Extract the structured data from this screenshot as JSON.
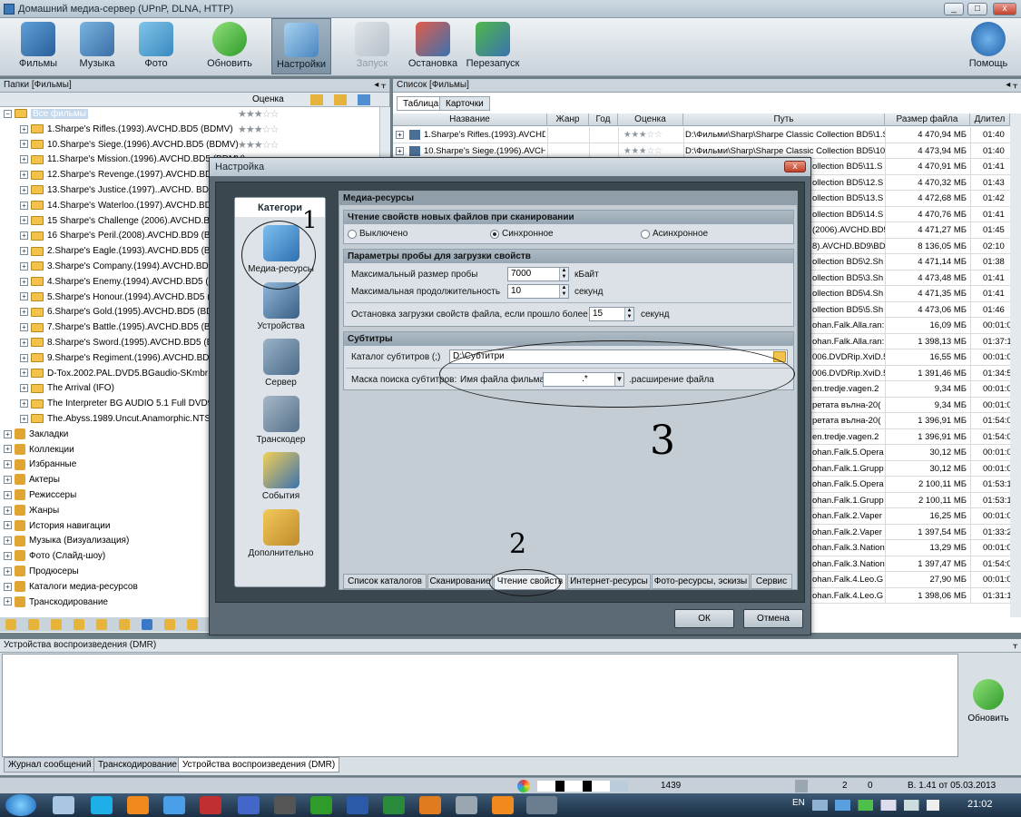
{
  "window": {
    "title": "Домашний медиа-сервер (UPnP, DLNA, HTTP)",
    "min": "_",
    "max": "□",
    "close": "x"
  },
  "toolbar": {
    "films": "Фильмы",
    "music": "Музыка",
    "photo": "Фото",
    "refresh": "Обновить",
    "settings": "Настройки",
    "start": "Запуск",
    "stop": "Остановка",
    "restart": "Перезапуск",
    "help": "Помощь"
  },
  "left": {
    "header": "Папки [Фильмы]",
    "rating_col": "Оценка",
    "root": "Все фильмы",
    "films": [
      "1.Sharpe's Rifles.(1993).AVCHD.BD5 (BDMV)",
      "10.Sharpe's Siege.(1996).AVCHD.BD5 (BDMV)",
      "11.Sharpe's Mission.(1996).AVCHD.BD5 (BDMV)",
      "12.Sharpe's Revenge.(1997).AVCHD.BD5 (BDMV)",
      "13.Sharpe's Justice.(1997)..AVCHD. BD5 (BDMV)",
      "14.Sharpe's Waterloo.(1997).AVCHD.BD5 (BDMV)",
      "15 Sharpe's Challenge (2006).AVCHD.BD5 (BDMV)",
      "16 Sharpe's Peril.(2008).AVCHD.BD9 (BDMV)",
      "2.Sharpe's Eagle.(1993).AVCHD.BD5 (BDMV)",
      "3.Sharpe's Company.(1994).AVCHD.BD5 (BDMV)",
      "4.Sharpe's Enemy.(1994).AVCHD.BD5 (BDMV)",
      "5.Sharpe's Honour.(1994).AVCHD.BD5 (BDMV)",
      "6.Sharpe's Gold.(1995).AVCHD.BD5 (BDMV)",
      "7.Sharpe's Battle.(1995).AVCHD.BD5 (BDMV)",
      "8.Sharpe's Sword.(1995).AVCHD.BD5 (BDMV)",
      "9.Sharpe's Regiment.(1996).AVCHD.BD5 (BDMV)",
      "D-Tox.2002.PAL.DVD5.BGaudio-SKmbr (IFO)",
      "The Arrival (IFO)",
      "The Interpreter BG AUDIO 5.1 Full DVD9 (IFO)",
      "The.Abyss.1989.Uncut.Anamorphic.NTSC (IFO)"
    ],
    "categories": [
      "Закладки",
      "Коллекции",
      "Избранные",
      "Актеры",
      "Режиссеры",
      "Жанры",
      "История навигации",
      "Музыка (Визуализация)",
      "Фото (Слайд-шоу)",
      "Продюсеры",
      "Каталоги медиа-ресурсов",
      "Транскодирование"
    ]
  },
  "right": {
    "header": "Список [Фильмы]",
    "tab_table": "Таблица",
    "tab_cards": "Карточки",
    "columns": [
      "Название",
      "Жанр",
      "Год",
      "Оценка",
      "Путь",
      "Размер файла",
      "Длител"
    ],
    "rows": [
      {
        "name": "1.Sharpe's Rifles.(1993).AVCHD.BD5",
        "path": "D:\\Фильми\\Sharp\\Sharpe Classic Collection BD5\\1.Sh",
        "size": "4 470,94 МБ",
        "dur": "01:40"
      },
      {
        "name": "10.Sharpe's Siege.(1996).AVCHD.BD5",
        "path": "D:\\Фильми\\Sharp\\Sharpe Classic Collection BD5\\10.S",
        "size": "4 473,94 МБ",
        "dur": "01:40"
      },
      {
        "path": "ollection BD5\\11.S",
        "size": "4 470,91 МБ",
        "dur": "01:41"
      },
      {
        "path": "ollection BD5\\12.S",
        "size": "4 470,32 МБ",
        "dur": "01:43"
      },
      {
        "path": "ollection BD5\\13.S",
        "size": "4 472,68 МБ",
        "dur": "01:42"
      },
      {
        "path": "ollection BD5\\14.S",
        "size": "4 470,76 МБ",
        "dur": "01:41"
      },
      {
        "path": "(2006).AVCHD.BD5",
        "size": "4 471,27 МБ",
        "dur": "01:45"
      },
      {
        "path": "8).AVCHD.BD9\\BDM",
        "size": "8 136,05 МБ",
        "dur": "02:10"
      },
      {
        "path": "ollection BD5\\2.Sh",
        "size": "4 471,14 МБ",
        "dur": "01:38"
      },
      {
        "path": "ollection BD5\\3.Sh",
        "size": "4 473,48 МБ",
        "dur": "01:41"
      },
      {
        "path": "ollection BD5\\4.Sh",
        "size": "4 471,35 МБ",
        "dur": "01:41"
      },
      {
        "path": "ollection BD5\\5.Sh",
        "size": "4 473,06 МБ",
        "dur": "01:46"
      },
      {
        "path": "ohan.Falk.Alla.ran:",
        "size": "16,09 МБ",
        "dur": "00:01:0"
      },
      {
        "path": "ohan.Falk.Alla.ran:",
        "size": "1 398,13 МБ",
        "dur": "01:37:1"
      },
      {
        "path": "006.DVDRip.XviD.5",
        "size": "16,55 МБ",
        "dur": "00:01:0"
      },
      {
        "path": "006.DVDRip.XviD.5",
        "size": "1 391,46 МБ",
        "dur": "01:34:5"
      },
      {
        "path": "en.tredje.vagen.2",
        "size": "9,34 МБ",
        "dur": "00:01:0"
      },
      {
        "path": "ретата вълна-20(",
        "size": "9,34 МБ",
        "dur": "00:01:0"
      },
      {
        "path": "ретата вълна-20(",
        "size": "1 396,91 МБ",
        "dur": "01:54:0"
      },
      {
        "path": "en.tredje.vagen.2",
        "size": "1 396,91 МБ",
        "dur": "01:54:0"
      },
      {
        "path": "ohan.Falk.5.Opera",
        "size": "30,12 МБ",
        "dur": "00:01:0"
      },
      {
        "path": "ohan.Falk.1.Grupp",
        "size": "30,12 МБ",
        "dur": "00:01:0"
      },
      {
        "path": "ohan.Falk.5.Opera",
        "size": "2 100,11 МБ",
        "dur": "01:53:1"
      },
      {
        "path": "ohan.Falk.1.Grupp",
        "size": "2 100,11 МБ",
        "dur": "01:53:1"
      },
      {
        "path": "ohan.Falk.2.Vaper",
        "size": "16,25 МБ",
        "dur": "00:01:0"
      },
      {
        "path": "ohan.Falk.2.Vaper",
        "size": "1 397,54 МБ",
        "dur": "01:33:2"
      },
      {
        "path": "ohan.Falk.3.Nation",
        "size": "13,29 МБ",
        "dur": "00:01:0"
      },
      {
        "path": "ohan.Falk.3.Nation",
        "size": "1 397,47 МБ",
        "dur": "01:54:0"
      },
      {
        "path": "ohan.Falk.4.Leo.G",
        "size": "27,90 МБ",
        "dur": "00:01:0"
      },
      {
        "path": "ohan.Falk.4.Leo.G",
        "size": "1 398,06 МБ",
        "dur": "01:31:1"
      }
    ]
  },
  "dialog": {
    "title": "Настройка",
    "close": "x",
    "categories_header": "Категори",
    "categories": [
      "Медиа-ресурсы",
      "Устройства",
      "Сервер",
      "Транскодер",
      "События",
      "Дополнительно"
    ],
    "section_title": "Медиа-ресурсы",
    "read_group": "Чтение свойств новых файлов при сканировании",
    "radio_off": "Выключено",
    "radio_sync": "Синхронное",
    "radio_async": "Асинхронное",
    "probe_group": "Параметры пробы для загрузки свойств",
    "max_probe_label": "Максимальный размер пробы",
    "max_probe_value": "7000",
    "max_probe_unit": "кБайт",
    "max_dur_label": "Максимальная продолжительность",
    "max_dur_value": "10",
    "max_dur_unit": "секунд",
    "stop_label": "Остановка загрузки свойств файла, если прошло более",
    "stop_value": "15",
    "stop_unit": "секунд",
    "subs_group": "Субтитры",
    "subs_dir_label": "Каталог субтитров (;)",
    "subs_dir_value": "D:\\Субтитри",
    "mask_label": "Маска поиска субтитров:",
    "mask_film": "Имя файла фильма",
    "mask_value": ".*",
    "mask_ext": ".расширение файла",
    "tabs": [
      "Список каталогов",
      "Сканирование",
      "Чтение свойств",
      "Интернет-ресурсы",
      "Фото-ресурсы, эскизы",
      "Сервис"
    ],
    "ok": "ОК",
    "cancel": "Отмена"
  },
  "annotations": {
    "one": "1",
    "two": "2",
    "three": "3"
  },
  "dmr": {
    "header": "Устройства воспроизведения (DMR)",
    "refresh": "Обновить",
    "tabs": [
      "Журнал сообщений",
      "Транскодирование",
      "Устройства воспроизведения (DMR)"
    ]
  },
  "status": {
    "count": "1439",
    "n1": "2",
    "n2": "0",
    "version": "В. 1.41 от 05.03.2013"
  },
  "taskbar": {
    "lang": "EN",
    "time": "21:02"
  }
}
